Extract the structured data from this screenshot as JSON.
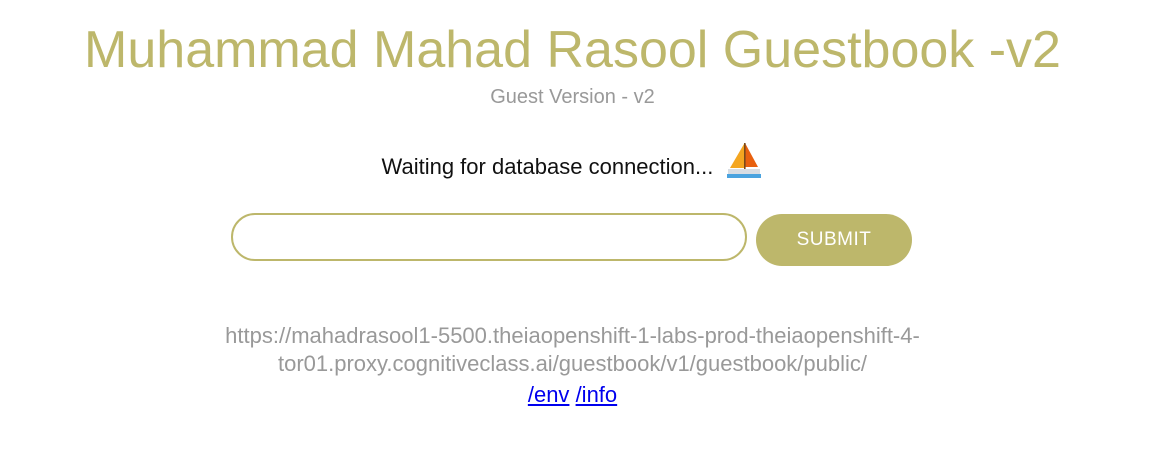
{
  "header": {
    "title": "Muhammad Mahad Rasool Guestbook -v2",
    "subtitle": "Guest Version - v2"
  },
  "status": {
    "message": "Waiting for database connection...",
    "icon": "sailboat-icon"
  },
  "form": {
    "entry_value": "",
    "entry_placeholder": "",
    "submit_label": "SUBMIT"
  },
  "footer": {
    "url_line1": "https://mahadrasool1-5500.theiaopenshift-1-labs-prod-theiaopenshift-4-",
    "url_line2": "tor01.proxy.cognitiveclass.ai/guestbook/v1/guestbook/public/",
    "env_link": "/env",
    "info_link": "/info"
  },
  "colors": {
    "accent": "#bdb76b",
    "muted_text": "#999999",
    "link": "#0000ee"
  }
}
